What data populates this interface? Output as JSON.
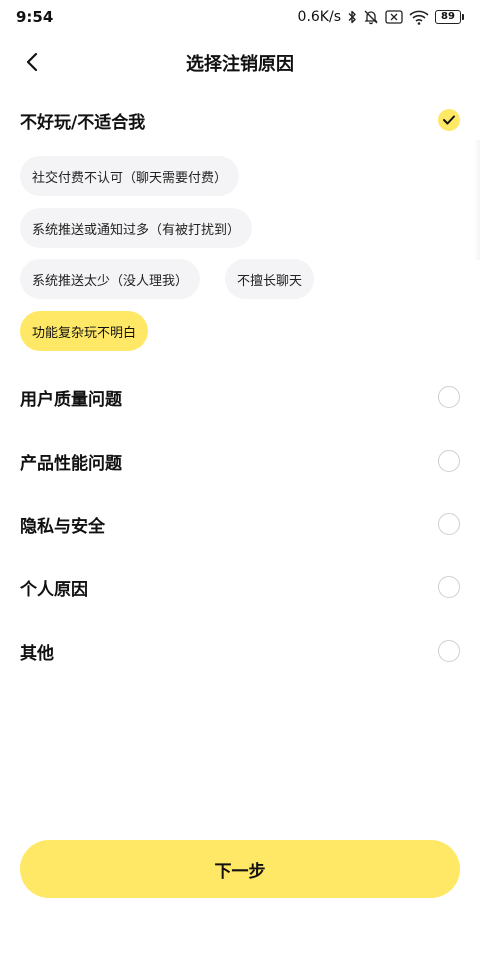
{
  "status_bar": {
    "time": "9:54",
    "network_speed": "0.6K/s",
    "battery": "89"
  },
  "header": {
    "title": "选择注销原因"
  },
  "reasons": [
    {
      "label": "不好玩/不适合我",
      "checked": true
    },
    {
      "label": "用户质量问题",
      "checked": false
    },
    {
      "label": "产品性能问题",
      "checked": false
    },
    {
      "label": "隐私与安全",
      "checked": false
    },
    {
      "label": "个人原因",
      "checked": false
    },
    {
      "label": "其他",
      "checked": false
    }
  ],
  "sub_reasons": [
    {
      "label": "社交付费不认可（聊天需要付费）",
      "selected": false
    },
    {
      "label": "系统推送或通知过多（有被打扰到）",
      "selected": false
    },
    {
      "label": "系统推送太少（没人理我）",
      "selected": false
    },
    {
      "label": "不擅长聊天",
      "selected": false
    },
    {
      "label": "功能复杂玩不明白",
      "selected": true
    }
  ],
  "next_button": {
    "label": "下一步"
  },
  "colors": {
    "accent": "#ffe866",
    "chip_bg": "#f4f4f6",
    "radio_border": "#cfcfcf"
  }
}
